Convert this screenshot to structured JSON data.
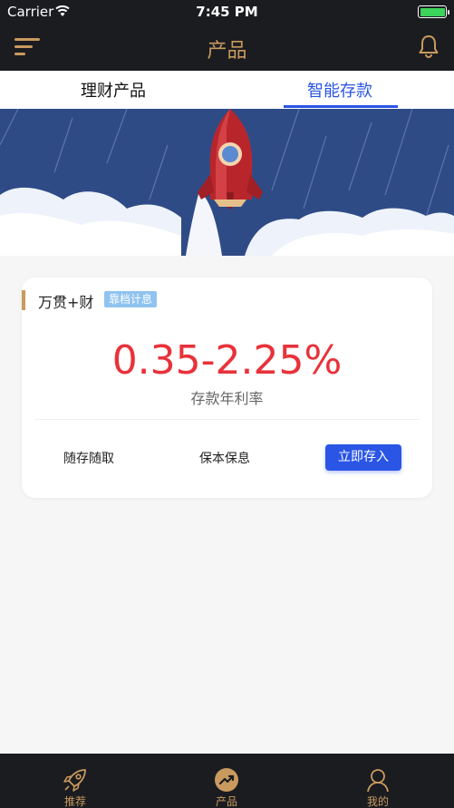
{
  "status_bar": {
    "carrier": "Carrier",
    "time": "7:45 PM"
  },
  "nav": {
    "title": "产品"
  },
  "tabs": [
    {
      "label": "理财产品",
      "active": false
    },
    {
      "label": "智能存款",
      "active": true
    }
  ],
  "product": {
    "name": "万贯+财",
    "badge": "靠档计息",
    "rate": "0.35-2.25%",
    "rate_label": "存款年利率",
    "features": [
      "随存随取",
      "保本保息"
    ],
    "action_label": "立即存入"
  },
  "tabbar": [
    {
      "label": "推荐",
      "icon": "rocket-icon"
    },
    {
      "label": "产品",
      "icon": "trend-icon"
    },
    {
      "label": "我的",
      "icon": "user-icon"
    }
  ],
  "colors": {
    "dark_bg": "#1b1c20",
    "gold": "#c99a5e",
    "blue": "#2a55e5",
    "rate_red": "#e8323a",
    "banner_bg": "#2f4b86"
  }
}
